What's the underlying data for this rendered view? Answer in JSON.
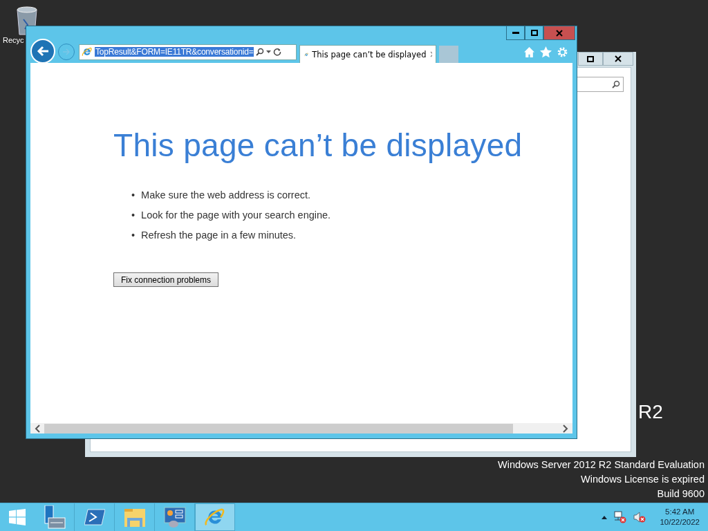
{
  "desktop": {
    "recycle_bin_label": "Recyc",
    "watermark_fragment": "R2",
    "edition": "Windows Server 2012 R2 Standard Evaluation",
    "license": "Windows License is expired",
    "build": "Build 9600"
  },
  "browser": {
    "address": "TopResult&FORM=IE11TR&conversationid=",
    "address_selected": true,
    "tabs": [
      {
        "title": "This page can’t be displayed",
        "selected": true
      }
    ],
    "heading": "This page can’t be displayed",
    "bullet": "•",
    "tips": [
      "Make sure the web address is correct.",
      "Look for the page with your search engine.",
      "Refresh the page in a few minutes."
    ],
    "button": "Fix connection problems"
  },
  "taskbar": {
    "apps": [
      {
        "kind": "start",
        "selected": false
      },
      {
        "kind": "server-manager",
        "selected": false
      },
      {
        "kind": "powershell",
        "selected": false
      },
      {
        "kind": "explorer",
        "selected": false
      },
      {
        "kind": "control-panel",
        "selected": false
      },
      {
        "kind": "browser",
        "selected": true
      }
    ],
    "time": "5:42 AM",
    "date": "10/22/2022"
  }
}
